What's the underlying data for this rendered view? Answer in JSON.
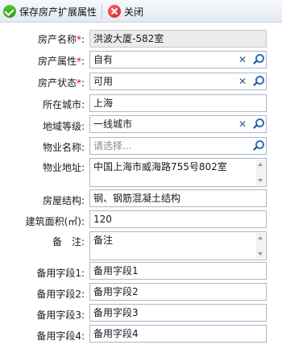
{
  "toolbar": {
    "save_label": "保存房产扩展属性",
    "close_label": "关闭"
  },
  "form": {
    "property_name": {
      "label": "房产名称",
      "required": "*",
      "suffix": ":",
      "value": "洪波大厦-582室"
    },
    "property_attr": {
      "label": "房产属性",
      "required": "*",
      "suffix": ":",
      "value": "自有"
    },
    "property_status": {
      "label": "房产状态",
      "required": "*",
      "suffix": ":",
      "value": "可用"
    },
    "city": {
      "label": "所在城市:",
      "value": "上海"
    },
    "region_level": {
      "label": "地域等级:",
      "value": "一线城市"
    },
    "property_mgmt": {
      "label": "物业名称:",
      "placeholder": "请选择..."
    },
    "property_address": {
      "label": "物业地址:",
      "value": "中国上海市威海路755号802室"
    },
    "structure": {
      "label": "房屋结构:",
      "value": "钢、钢筋混凝土结构"
    },
    "area": {
      "label": "建筑面积(㎡):",
      "value": "120"
    },
    "remark": {
      "label": "备　注:",
      "value": "备注"
    },
    "spare1": {
      "label": "备用字段1:",
      "value": "备用字段1"
    },
    "spare2": {
      "label": "备用字段2:",
      "value": "备用字段2"
    },
    "spare3": {
      "label": "备用字段3:",
      "value": "备用字段3"
    },
    "spare4": {
      "label": "备用字段4:",
      "value": "备用字段4"
    }
  },
  "icons": {
    "save": "check-circle-icon",
    "close": "close-circle-icon",
    "clear": "clear-x-icon",
    "search": "search-icon"
  }
}
